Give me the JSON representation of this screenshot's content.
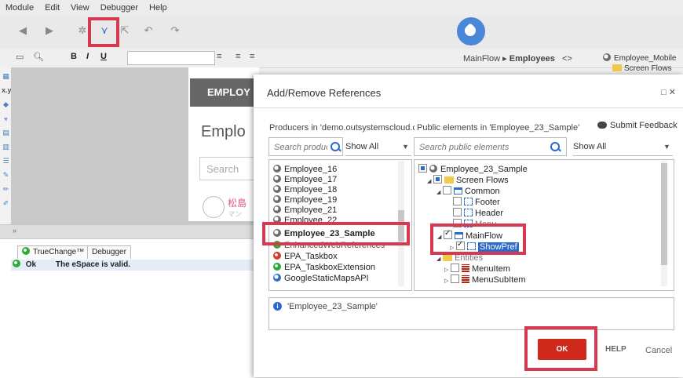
{
  "menu": {
    "items": [
      "Module",
      "Edit",
      "View",
      "Debugger",
      "Help"
    ]
  },
  "toolbar": {
    "format_buttons": [
      "B",
      "I",
      "U"
    ]
  },
  "breadcrumb": {
    "flow": "MainFlow",
    "separator": "▸",
    "screen": "Employees",
    "nav": "<>"
  },
  "right_tree": {
    "root": "Employee_Mobile",
    "child": "Screen Flows"
  },
  "canvas": {
    "header": "EMPLOY",
    "title": "Emplo",
    "search_placeholder": "Search",
    "jp_name": "松島",
    "jp_sub": "マン"
  },
  "bottom_panel": {
    "tabs": [
      "TrueChange™",
      "Debugger"
    ],
    "status_label": "Ok",
    "status_message": "The eSpace is valid."
  },
  "dialog": {
    "title": "Add/Remove References",
    "close_label": "□ ✕",
    "feedback_label": "Submit Feedback",
    "producers_label": "Producers in 'demo.outsystemscloud.co",
    "public_label": "Public elements in 'Employee_23_Sample'",
    "producers_search_placeholder": "Search producers",
    "public_search_placeholder": "Search public elements",
    "producers_filter": "Show All",
    "public_filter": "Show All",
    "producers": [
      {
        "name": "Employee_16",
        "icon": "module-icon"
      },
      {
        "name": "Employee_17",
        "icon": "module-icon"
      },
      {
        "name": "Employee_18",
        "icon": "module-icon"
      },
      {
        "name": "Employee_19",
        "icon": "module-icon"
      },
      {
        "name": "Employee_21",
        "icon": "module-icon"
      },
      {
        "name": "Employee_22",
        "icon": "module-icon"
      },
      {
        "name": "Employee_23_Sample",
        "icon": "module-icon",
        "selected": true
      },
      {
        "name": "EnhancedWebReferences",
        "icon": "module-icon"
      },
      {
        "name": "EPA_Taskbox",
        "icon": "module-red-icon"
      },
      {
        "name": "EPA_TaskboxExtension",
        "icon": "extension-green-icon"
      },
      {
        "name": "GoogleStaticMapsAPI",
        "icon": "module-blue-icon"
      }
    ],
    "public_tree": [
      {
        "label": "Employee_23_Sample"
      },
      {
        "label": "Screen Flows"
      },
      {
        "label": "Common"
      },
      {
        "label": "Footer"
      },
      {
        "label": "Header"
      },
      {
        "label": "Menu"
      },
      {
        "label": "MainFlow"
      },
      {
        "label": "ShowPref"
      },
      {
        "label": "Entities"
      },
      {
        "label": "MenuItem"
      },
      {
        "label": "MenuSubItem"
      }
    ],
    "info_icon_glyph": "i",
    "info_text": "'Employee_23_Sample'",
    "ok_label": "OK",
    "help_label": "HELP",
    "cancel_label": "Cancel"
  },
  "colors": {
    "ok_button": "#cf2a19",
    "highlight": "#d63a52",
    "accent": "#2a6acb"
  }
}
